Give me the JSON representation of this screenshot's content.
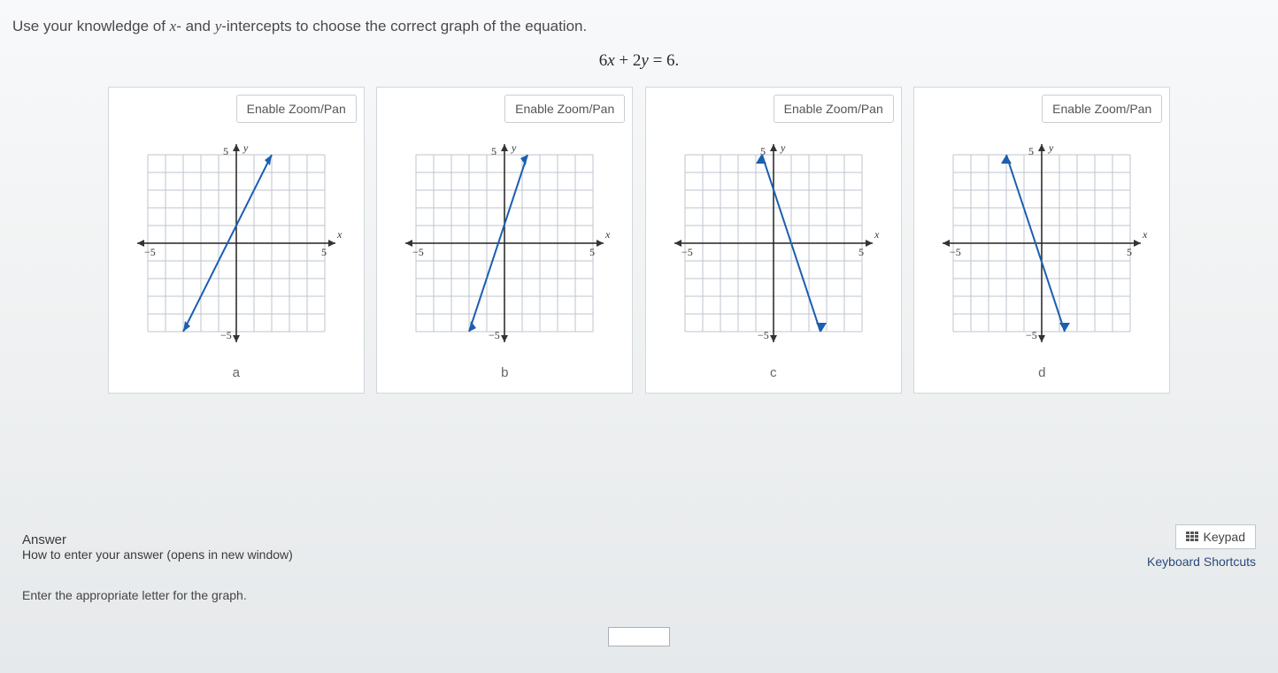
{
  "question_prefix": "Use your knowledge of ",
  "question_x": "x",
  "question_mid1": "- and ",
  "question_y": "y",
  "question_mid2": "-intercepts to choose the correct graph of the equation.",
  "equation_html": "6x + 2y = 6.",
  "equation_parts": {
    "a": "6",
    "x": "x",
    "plus": " + ",
    "b": "2",
    "y": "y",
    "eq": " = ",
    "c": "6."
  },
  "zoom_label": "Enable Zoom/Pan",
  "graphs": {
    "a": {
      "label": "a"
    },
    "b": {
      "label": "b"
    },
    "c": {
      "label": "c"
    },
    "d": {
      "label": "d"
    }
  },
  "axis": {
    "xmin": -5,
    "xmax": 5,
    "ymin": -5,
    "ymax": 5,
    "x_label": "x",
    "y_label": "y",
    "neg5": "−5",
    "pos5": "5",
    "top5": "5",
    "bot5": "−5"
  },
  "chart_data": [
    {
      "id": "a",
      "type": "line",
      "xlim": [
        -5,
        5
      ],
      "ylim": [
        -5,
        5
      ],
      "line_points": [
        [
          -3,
          -5
        ],
        [
          2,
          5
        ]
      ],
      "x_intercept": -0.5,
      "y_intercept": 1,
      "slope": 2
    },
    {
      "id": "b",
      "type": "line",
      "xlim": [
        -5,
        5
      ],
      "ylim": [
        -5,
        5
      ],
      "line_points": [
        [
          -2,
          -5
        ],
        [
          1,
          4
        ]
      ],
      "x_intercept": -0.33,
      "y_intercept": 1,
      "slope": 3
    },
    {
      "id": "c",
      "type": "line",
      "xlim": [
        -5,
        5
      ],
      "ylim": [
        -5,
        5
      ],
      "line_points": [
        [
          -1,
          5
        ],
        [
          2,
          -4
        ]
      ],
      "x_intercept": 0.67,
      "y_intercept": 2,
      "slope": -3
    },
    {
      "id": "d",
      "type": "line",
      "xlim": [
        -5,
        5
      ],
      "ylim": [
        -5,
        5
      ],
      "line_points": [
        [
          -2,
          5
        ],
        [
          1,
          -4
        ]
      ],
      "x_intercept": -0.33,
      "y_intercept": -1,
      "slope": -3
    }
  ],
  "answer": {
    "title": "Answer",
    "hint": "How to enter your answer (opens in new window)",
    "keypad": "Keypad",
    "shortcuts": "Keyboard Shortcuts",
    "enter_letter": "Enter the appropriate letter for the graph.",
    "value": ""
  }
}
